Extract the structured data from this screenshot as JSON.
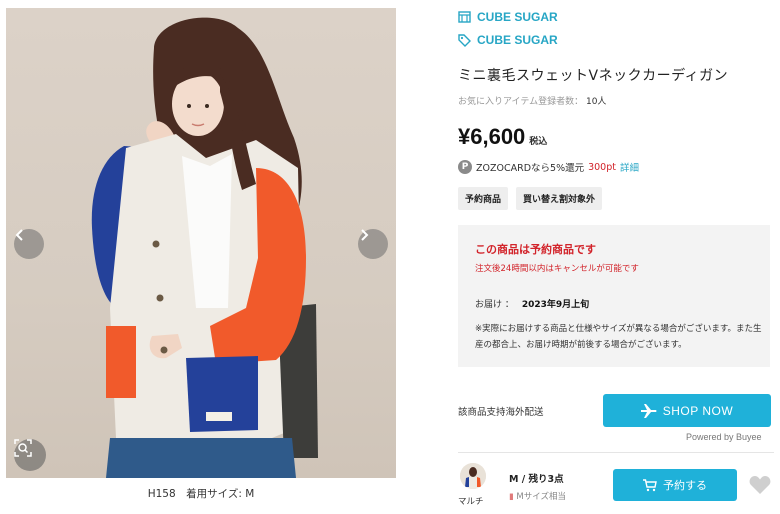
{
  "gallery": {
    "prev_icon": "chevron-left",
    "next_icon": "chevron-right",
    "zoom_icon": "magnifier-zoom",
    "caption": "H158　着用サイズ: M",
    "colors": {
      "background": "#d8cec3",
      "navy": "#24419a",
      "orange": "#f15a2b",
      "body": "#efebe4"
    }
  },
  "brand": {
    "shop_name": "CUBE SUGAR",
    "brand_name": "CUBE SUGAR",
    "shop_icon": "shop-icon",
    "brand_icon": "tag-icon",
    "accent": "#27a6c5"
  },
  "product": {
    "title": "ミニ裏毛スウェットVネックカーディガン",
    "favorites_label": "お気に入りアイテム登録者数：",
    "favorites_count": "10人",
    "price": "¥6,600",
    "tax_label": "税込",
    "points_badge": "P",
    "points_prefix": "ZOZOCARDなら5%還元",
    "points_value": "300pt",
    "points_detail": "詳細",
    "tags": [
      "予約商品",
      "買い替え割対象外"
    ]
  },
  "notice": {
    "title": "この商品は予約商品です",
    "subtitle": "注文後24時間以内はキャンセルが可能です",
    "delivery_label": "お届け ：",
    "delivery_value": "2023年9月上旬",
    "body": "※実際にお届けする商品と仕様やサイズが異なる場合がございます。また生産の都合上、お届け時期が前後する場合がございます。"
  },
  "purchase": {
    "overseas_label": "該商品支持海外配送",
    "shop_now": "SHOP NOW",
    "shop_now_icon": "airplane-icon",
    "powered_by": "Powered by Buyee",
    "button_color": "#1fb1d9"
  },
  "variant": {
    "color_label": "マルチ",
    "size_stock": "M / 残り3点",
    "size_note": "Mサイズ相当",
    "reserve_button": "予約する",
    "cart_icon": "cart-icon",
    "favorite_icon": "heart-icon"
  }
}
